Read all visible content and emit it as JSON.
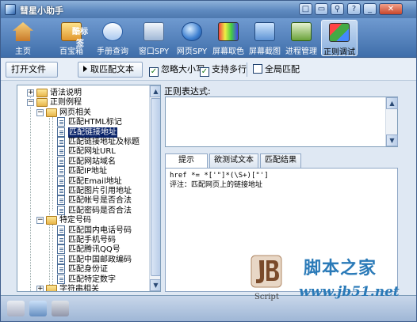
{
  "window": {
    "title": "彗星小助手",
    "controls": [
      "□",
      "▭",
      "⚲",
      "?",
      "_",
      "✕"
    ]
  },
  "toolbar": {
    "items": [
      {
        "label": "主页",
        "icon": "home-icon"
      },
      {
        "label": "百宝箱",
        "icon": "toolbox-icon"
      },
      {
        "label": "手册查询",
        "icon": "manual-icon"
      },
      {
        "label": "窗口SPY",
        "icon": "window-spy-icon"
      },
      {
        "label": "网页SPY",
        "icon": "web-spy-icon"
      },
      {
        "label": "屏幕取色",
        "icon": "color-picker-icon"
      },
      {
        "label": "屏幕截图",
        "icon": "screenshot-icon"
      },
      {
        "label": "进程管理",
        "icon": "process-icon"
      },
      {
        "label": "正则调试",
        "icon": "regex-icon",
        "active": true
      }
    ],
    "overlay_text": "酷标签"
  },
  "actions": {
    "open_file": "打开文件",
    "get_match": "取匹配文本",
    "ignore_case": {
      "label": "忽略大小写",
      "checked": true
    },
    "multiline": {
      "label": "支持多行",
      "checked": true
    },
    "global": {
      "label": "全局匹配",
      "checked": false
    }
  },
  "tree": {
    "nodes": [
      {
        "label": "语法说明",
        "type": "folder",
        "level": 0,
        "expander": "+"
      },
      {
        "label": "正则例程",
        "type": "folder",
        "level": 0,
        "expander": "−"
      },
      {
        "label": "网页相关",
        "type": "folder",
        "level": 1,
        "expander": "−"
      },
      {
        "label": "匹配HTML标记",
        "type": "doc",
        "level": 2
      },
      {
        "label": "匹配链接地址",
        "type": "doc",
        "level": 2,
        "selected": true
      },
      {
        "label": "匹配链接地址及标题",
        "type": "doc",
        "level": 2
      },
      {
        "label": "匹配网址URL",
        "type": "doc",
        "level": 2
      },
      {
        "label": "匹配网站域名",
        "type": "doc",
        "level": 2
      },
      {
        "label": "匹配IP地址",
        "type": "doc",
        "level": 2
      },
      {
        "label": "匹配Email地址",
        "type": "doc",
        "level": 2
      },
      {
        "label": "匹配图片引用地址",
        "type": "doc",
        "level": 2
      },
      {
        "label": "匹配帐号是否合法",
        "type": "doc",
        "level": 2
      },
      {
        "label": "匹配密码是否合法",
        "type": "doc",
        "level": 2
      },
      {
        "label": "特定号码",
        "type": "folder",
        "level": 1,
        "expander": "−"
      },
      {
        "label": "匹配国内电话号码",
        "type": "doc",
        "level": 2
      },
      {
        "label": "匹配手机号码",
        "type": "doc",
        "level": 2
      },
      {
        "label": "匹配腾讯QQ号",
        "type": "doc",
        "level": 2
      },
      {
        "label": "匹配中国邮政编码",
        "type": "doc",
        "level": 2
      },
      {
        "label": "匹配身份证",
        "type": "doc",
        "level": 2
      },
      {
        "label": "匹配特定数字",
        "type": "doc",
        "level": 2
      },
      {
        "label": "字符串相关",
        "type": "folder",
        "level": 1,
        "expander": "+"
      }
    ]
  },
  "regex": {
    "label": "正则表达式:",
    "value": ""
  },
  "tabs": {
    "items": [
      "提示",
      "欲测试文本",
      "匹配结果"
    ],
    "active": "提示"
  },
  "hint": {
    "line1": "href *= *['\"]*(\\S+)[\"']",
    "line2": "评注：匹配网页上的链接地址"
  },
  "watermark": {
    "cn": "脚本之家",
    "url": "www.jb51.net",
    "script": "Script"
  },
  "colors": {
    "titlebar": "#5f8ac0",
    "selection": "#0a246a",
    "watermark": "#2a7ab8"
  }
}
